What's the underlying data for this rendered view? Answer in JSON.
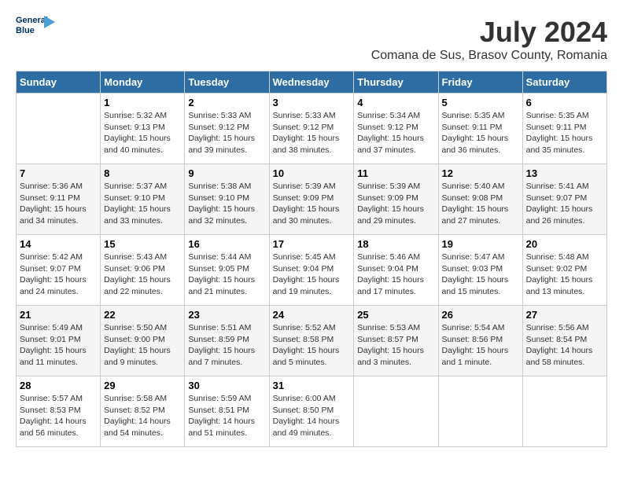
{
  "header": {
    "logo_line1": "General",
    "logo_line2": "Blue",
    "month_year": "July 2024",
    "location": "Comana de Sus, Brasov County, Romania"
  },
  "weekdays": [
    "Sunday",
    "Monday",
    "Tuesday",
    "Wednesday",
    "Thursday",
    "Friday",
    "Saturday"
  ],
  "weeks": [
    [
      {
        "day": "",
        "info": ""
      },
      {
        "day": "1",
        "info": "Sunrise: 5:32 AM\nSunset: 9:13 PM\nDaylight: 15 hours\nand 40 minutes."
      },
      {
        "day": "2",
        "info": "Sunrise: 5:33 AM\nSunset: 9:12 PM\nDaylight: 15 hours\nand 39 minutes."
      },
      {
        "day": "3",
        "info": "Sunrise: 5:33 AM\nSunset: 9:12 PM\nDaylight: 15 hours\nand 38 minutes."
      },
      {
        "day": "4",
        "info": "Sunrise: 5:34 AM\nSunset: 9:12 PM\nDaylight: 15 hours\nand 37 minutes."
      },
      {
        "day": "5",
        "info": "Sunrise: 5:35 AM\nSunset: 9:11 PM\nDaylight: 15 hours\nand 36 minutes."
      },
      {
        "day": "6",
        "info": "Sunrise: 5:35 AM\nSunset: 9:11 PM\nDaylight: 15 hours\nand 35 minutes."
      }
    ],
    [
      {
        "day": "7",
        "info": "Sunrise: 5:36 AM\nSunset: 9:11 PM\nDaylight: 15 hours\nand 34 minutes."
      },
      {
        "day": "8",
        "info": "Sunrise: 5:37 AM\nSunset: 9:10 PM\nDaylight: 15 hours\nand 33 minutes."
      },
      {
        "day": "9",
        "info": "Sunrise: 5:38 AM\nSunset: 9:10 PM\nDaylight: 15 hours\nand 32 minutes."
      },
      {
        "day": "10",
        "info": "Sunrise: 5:39 AM\nSunset: 9:09 PM\nDaylight: 15 hours\nand 30 minutes."
      },
      {
        "day": "11",
        "info": "Sunrise: 5:39 AM\nSunset: 9:09 PM\nDaylight: 15 hours\nand 29 minutes."
      },
      {
        "day": "12",
        "info": "Sunrise: 5:40 AM\nSunset: 9:08 PM\nDaylight: 15 hours\nand 27 minutes."
      },
      {
        "day": "13",
        "info": "Sunrise: 5:41 AM\nSunset: 9:07 PM\nDaylight: 15 hours\nand 26 minutes."
      }
    ],
    [
      {
        "day": "14",
        "info": "Sunrise: 5:42 AM\nSunset: 9:07 PM\nDaylight: 15 hours\nand 24 minutes."
      },
      {
        "day": "15",
        "info": "Sunrise: 5:43 AM\nSunset: 9:06 PM\nDaylight: 15 hours\nand 22 minutes."
      },
      {
        "day": "16",
        "info": "Sunrise: 5:44 AM\nSunset: 9:05 PM\nDaylight: 15 hours\nand 21 minutes."
      },
      {
        "day": "17",
        "info": "Sunrise: 5:45 AM\nSunset: 9:04 PM\nDaylight: 15 hours\nand 19 minutes."
      },
      {
        "day": "18",
        "info": "Sunrise: 5:46 AM\nSunset: 9:04 PM\nDaylight: 15 hours\nand 17 minutes."
      },
      {
        "day": "19",
        "info": "Sunrise: 5:47 AM\nSunset: 9:03 PM\nDaylight: 15 hours\nand 15 minutes."
      },
      {
        "day": "20",
        "info": "Sunrise: 5:48 AM\nSunset: 9:02 PM\nDaylight: 15 hours\nand 13 minutes."
      }
    ],
    [
      {
        "day": "21",
        "info": "Sunrise: 5:49 AM\nSunset: 9:01 PM\nDaylight: 15 hours\nand 11 minutes."
      },
      {
        "day": "22",
        "info": "Sunrise: 5:50 AM\nSunset: 9:00 PM\nDaylight: 15 hours\nand 9 minutes."
      },
      {
        "day": "23",
        "info": "Sunrise: 5:51 AM\nSunset: 8:59 PM\nDaylight: 15 hours\nand 7 minutes."
      },
      {
        "day": "24",
        "info": "Sunrise: 5:52 AM\nSunset: 8:58 PM\nDaylight: 15 hours\nand 5 minutes."
      },
      {
        "day": "25",
        "info": "Sunrise: 5:53 AM\nSunset: 8:57 PM\nDaylight: 15 hours\nand 3 minutes."
      },
      {
        "day": "26",
        "info": "Sunrise: 5:54 AM\nSunset: 8:56 PM\nDaylight: 15 hours\nand 1 minute."
      },
      {
        "day": "27",
        "info": "Sunrise: 5:56 AM\nSunset: 8:54 PM\nDaylight: 14 hours\nand 58 minutes."
      }
    ],
    [
      {
        "day": "28",
        "info": "Sunrise: 5:57 AM\nSunset: 8:53 PM\nDaylight: 14 hours\nand 56 minutes."
      },
      {
        "day": "29",
        "info": "Sunrise: 5:58 AM\nSunset: 8:52 PM\nDaylight: 14 hours\nand 54 minutes."
      },
      {
        "day": "30",
        "info": "Sunrise: 5:59 AM\nSunset: 8:51 PM\nDaylight: 14 hours\nand 51 minutes."
      },
      {
        "day": "31",
        "info": "Sunrise: 6:00 AM\nSunset: 8:50 PM\nDaylight: 14 hours\nand 49 minutes."
      },
      {
        "day": "",
        "info": ""
      },
      {
        "day": "",
        "info": ""
      },
      {
        "day": "",
        "info": ""
      }
    ]
  ]
}
